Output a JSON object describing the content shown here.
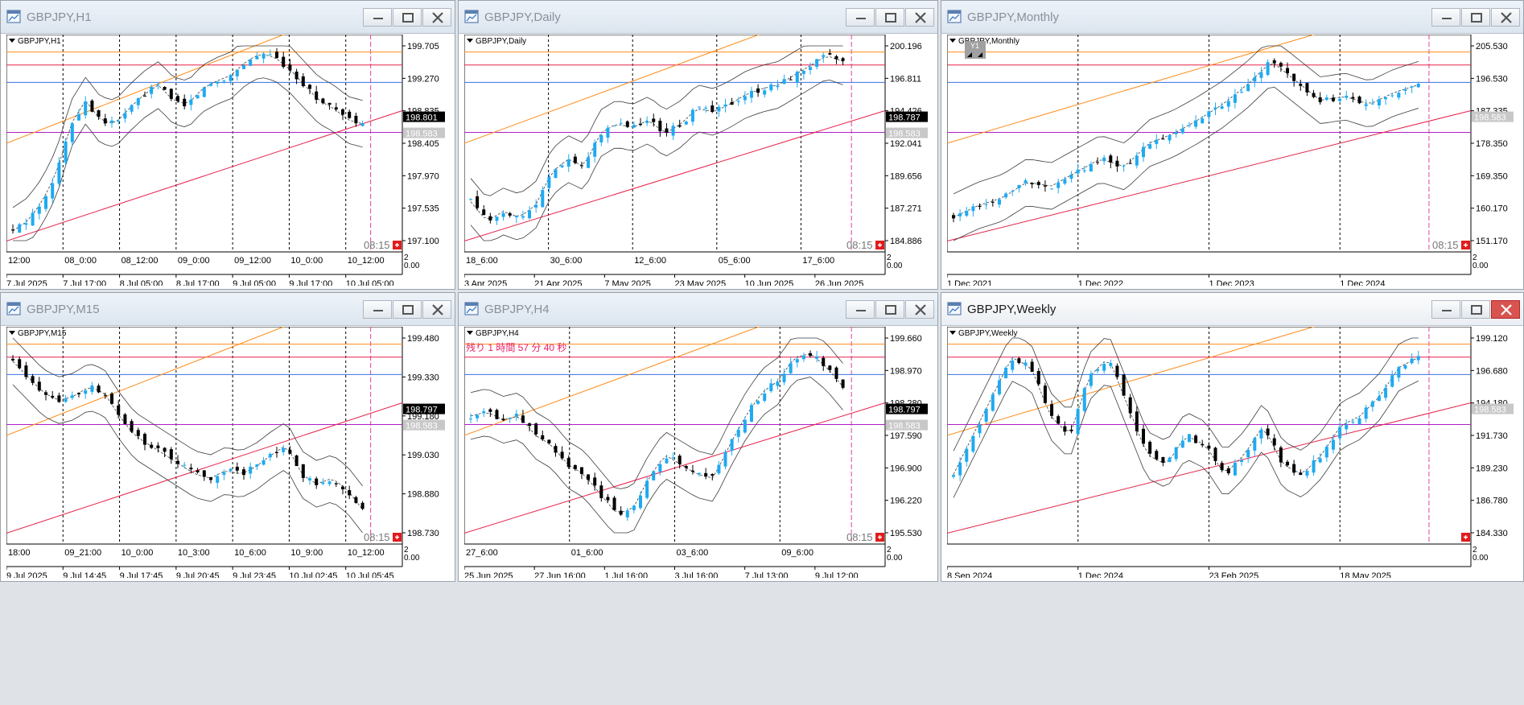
{
  "windows": [
    {
      "id": "h1",
      "title": "GBPJPY,H1",
      "label": "GBPJPY,H1",
      "active": false,
      "yticks": [
        "199.705",
        "199.270",
        "198.835",
        "198.405",
        "197.970",
        "197.535",
        "197.100"
      ],
      "price_tags": [
        {
          "text": "198.801",
          "bg": "#000000",
          "fg": "#ffffff"
        },
        {
          "text": "198.583",
          "bg": "#c8c8c8",
          "fg": "#ffffff"
        }
      ],
      "timer": "08:15",
      "xticks_top": [
        "12:00",
        "08_0:00",
        "08_12:00",
        "09_0:00",
        "09_12:00",
        "10_0:00",
        "10_12:00"
      ],
      "xticks_bottom": [
        "7 Jul 2025",
        "7 Jul 17:00",
        "8 Jul 05:00",
        "8 Jul 17:00",
        "9 Jul 05:00",
        "9 Jul 17:00",
        "10 Jul 05:00"
      ],
      "corner": "0.00",
      "corner_top": "2"
    },
    {
      "id": "daily",
      "title": "GBPJPY,Daily",
      "label": "GBPJPY,Daily",
      "active": false,
      "yticks": [
        "200.196",
        "196.811",
        "194.426",
        "192.041",
        "189.656",
        "187.271",
        "184.886"
      ],
      "price_tags": [
        {
          "text": "198.787",
          "bg": "#000000",
          "fg": "#ffffff"
        },
        {
          "text": "198.583",
          "bg": "#c8c8c8",
          "fg": "#ffffff"
        }
      ],
      "timer": "08:15",
      "xticks_top": [
        "18_6:00",
        "30_6:00",
        "12_6:00",
        "05_6:00",
        "17_6:00"
      ],
      "xticks_bottom": [
        "3 Apr 2025",
        "21 Apr 2025",
        "7 May 2025",
        "23 May 2025",
        "10 Jun 2025",
        "26 Jun 2025"
      ],
      "corner": "0.00",
      "corner_top": "2"
    },
    {
      "id": "monthly",
      "title": "GBPJPY,Monthly",
      "label": "GBPJPY,Monthly",
      "active": false,
      "yticks": [
        "205.530",
        "196.530",
        "187.335",
        "178.350",
        "169.350",
        "160.170",
        "151.170"
      ],
      "price_tags": [
        {
          "text": "198.583",
          "bg": "#c8c8c8",
          "fg": "#ffffff"
        }
      ],
      "timer": "08:15",
      "badge": "Y1",
      "xticks_top": [],
      "xticks_bottom": [
        "1 Dec 2021",
        "1 Dec 2022",
        "1 Dec 2023",
        "1 Dec 2024"
      ],
      "corner": "0.00",
      "corner_top": "2"
    },
    {
      "id": "m15",
      "title": "GBPJPY,M15",
      "label": "GBPJPY,M15",
      "active": false,
      "yticks": [
        "199.480",
        "199.330",
        "199.180",
        "199.030",
        "198.880",
        "198.730"
      ],
      "price_tags": [
        {
          "text": "198.797",
          "bg": "#000000",
          "fg": "#ffffff"
        },
        {
          "text": "198.583",
          "bg": "#c8c8c8",
          "fg": "#ffffff"
        }
      ],
      "timer": "08:15",
      "xticks_top": [
        "18:00",
        "09_21:00",
        "10_0:00",
        "10_3:00",
        "10_6:00",
        "10_9:00",
        "10_12:00"
      ],
      "xticks_bottom": [
        "9 Jul 2025",
        "9 Jul 14:45",
        "9 Jul 17:45",
        "9 Jul 20:45",
        "9 Jul 23:45",
        "10 Jul 02:45",
        "10 Jul 05:45"
      ],
      "corner": "0.00",
      "corner_top": "2"
    },
    {
      "id": "h4",
      "title": "GBPJPY,H4",
      "label": "GBPJPY,H4",
      "active": false,
      "countdown": "残り 1 時間 57 分 40 秒",
      "yticks": [
        "199.660",
        "198.970",
        "198.280",
        "197.590",
        "196.900",
        "196.220",
        "195.530"
      ],
      "price_tags": [
        {
          "text": "198.797",
          "bg": "#000000",
          "fg": "#ffffff"
        },
        {
          "text": "198.583",
          "bg": "#c8c8c8",
          "fg": "#ffffff"
        }
      ],
      "timer": "08:15",
      "xticks_top": [
        "27_6:00",
        "01_6:00",
        "03_6:00",
        "09_6:00"
      ],
      "xticks_bottom": [
        "25 Jun 2025",
        "27 Jun 16:00",
        "1 Jul 16:00",
        "3 Jul 16:00",
        "7 Jul 13:00",
        "9 Jul 12:00"
      ],
      "corner": "0.00",
      "corner_top": "2"
    },
    {
      "id": "weekly",
      "title": "GBPJPY,Weekly",
      "label": "GBPJPY,Weekly",
      "active": true,
      "yticks": [
        "199.120",
        "196.680",
        "194.180",
        "191.730",
        "189.230",
        "186.780",
        "184.330"
      ],
      "price_tags": [
        {
          "text": "198.583",
          "bg": "#c8c8c8",
          "fg": "#ffffff"
        }
      ],
      "timer": "",
      "xticks_top": [],
      "xticks_bottom": [
        "8 Sep 2024",
        "1 Dec 2024",
        "23 Feb 2025",
        "18 May 2025"
      ],
      "corner": "0.00",
      "corner_top": "2"
    }
  ],
  "colors": {
    "bull": "#1eaaf1",
    "bear": "#000000",
    "band": "#3c3c3c",
    "orange": "#ff8c1a",
    "red": "#e8204a",
    "blue": "#3c6fe0",
    "purple": "#b020c8",
    "green": "#6b8e23",
    "magenta_dash": "#e040a0",
    "grid_dash": "#000000"
  },
  "icons": {
    "window": "chart-window-icon",
    "minimize": "minimize-icon",
    "maximize": "maximize-icon",
    "close": "close-icon",
    "add": "plus-icon"
  }
}
